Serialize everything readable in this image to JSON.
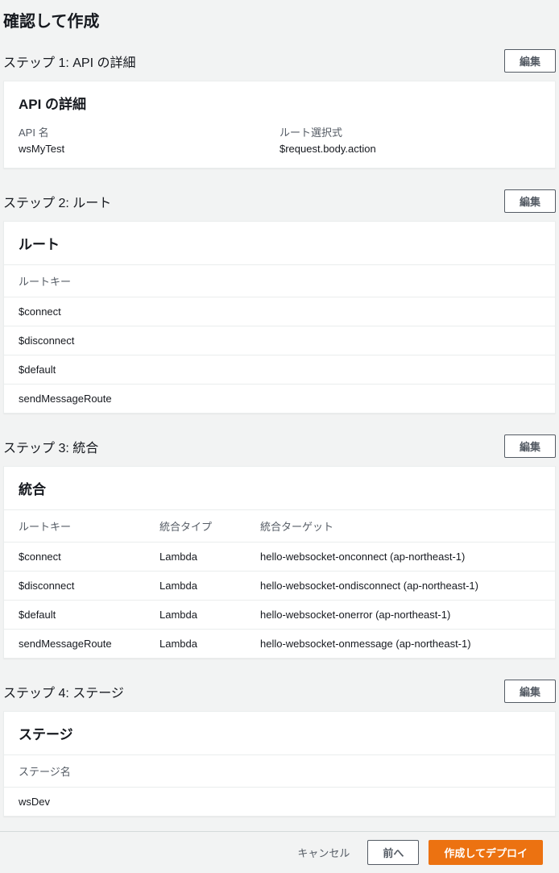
{
  "page": {
    "title": "確認して作成"
  },
  "step1": {
    "title": "ステップ 1: API の詳細",
    "editLabel": "編集",
    "cardTitle": "API の詳細",
    "apiNameLabel": "API 名",
    "apiNameValue": "wsMyTest",
    "routeSelectionLabel": "ルート選択式",
    "routeSelectionValue": "$request.body.action"
  },
  "step2": {
    "title": "ステップ 2: ルート",
    "editLabel": "編集",
    "cardTitle": "ルート",
    "header": {
      "routeKey": "ルートキー"
    },
    "rows": [
      {
        "routeKey": "$connect"
      },
      {
        "routeKey": "$disconnect"
      },
      {
        "routeKey": "$default"
      },
      {
        "routeKey": "sendMessageRoute"
      }
    ]
  },
  "step3": {
    "title": "ステップ 3: 統合",
    "editLabel": "編集",
    "cardTitle": "統合",
    "header": {
      "routeKey": "ルートキー",
      "integrationType": "統合タイプ",
      "integrationTarget": "統合ターゲット"
    },
    "rows": [
      {
        "routeKey": "$connect",
        "integrationType": "Lambda",
        "integrationTarget": "hello-websocket-onconnect (ap-northeast-1)"
      },
      {
        "routeKey": "$disconnect",
        "integrationType": "Lambda",
        "integrationTarget": "hello-websocket-ondisconnect (ap-northeast-1)"
      },
      {
        "routeKey": "$default",
        "integrationType": "Lambda",
        "integrationTarget": "hello-websocket-onerror (ap-northeast-1)"
      },
      {
        "routeKey": "sendMessageRoute",
        "integrationType": "Lambda",
        "integrationTarget": "hello-websocket-onmessage (ap-northeast-1)"
      }
    ]
  },
  "step4": {
    "title": "ステップ 4: ステージ",
    "editLabel": "編集",
    "cardTitle": "ステージ",
    "header": {
      "stageName": "ステージ名"
    },
    "rows": [
      {
        "stageName": "wsDev"
      }
    ]
  },
  "footer": {
    "cancel": "キャンセル",
    "previous": "前へ",
    "createDeploy": "作成してデプロイ"
  }
}
